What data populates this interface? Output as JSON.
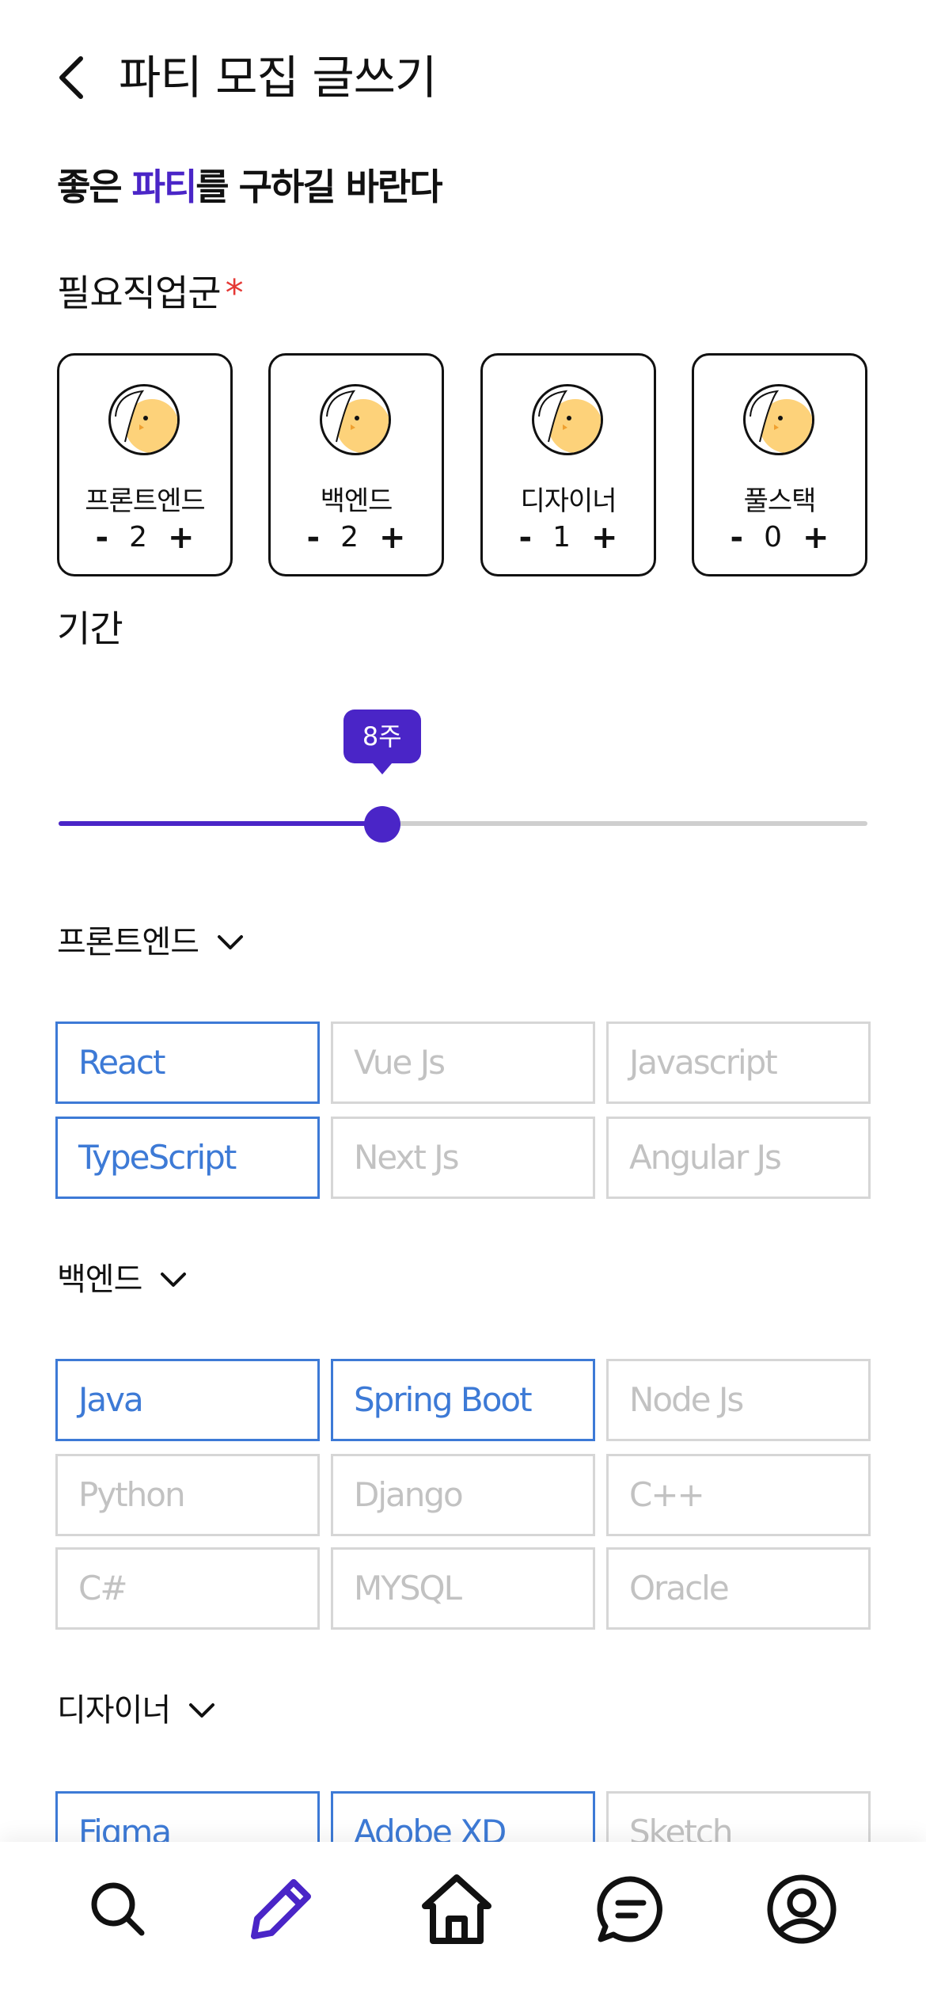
{
  "header": {
    "title": "파티 모집 글쓰기"
  },
  "headline": {
    "before": "좋은 ",
    "accent": "파티",
    "after": "를 구하길 바란다"
  },
  "roles_section": {
    "label": "필요직업군",
    "required_mark": "*"
  },
  "roles": [
    {
      "name": "프론트엔드",
      "count": "2",
      "minus": "-",
      "plus": "+"
    },
    {
      "name": "백엔드",
      "count": "2",
      "minus": "-",
      "plus": "+"
    },
    {
      "name": "디자이너",
      "count": "1",
      "minus": "-",
      "plus": "+"
    },
    {
      "name": "풀스택",
      "count": "0",
      "minus": "-",
      "plus": "+"
    }
  ],
  "period": {
    "label": "기간",
    "value_label": "8주",
    "fraction": 0.4
  },
  "frontend": {
    "label": "프론트엔드",
    "skills": [
      {
        "name": "React",
        "selected": true
      },
      {
        "name": "Vue Js",
        "selected": false
      },
      {
        "name": "Javascript",
        "selected": false
      },
      {
        "name": "TypeScript",
        "selected": true
      },
      {
        "name": "Next Js",
        "selected": false
      },
      {
        "name": "Angular Js",
        "selected": false
      }
    ]
  },
  "backend": {
    "label": "백엔드",
    "skills": [
      {
        "name": "Java",
        "selected": true
      },
      {
        "name": "Spring Boot",
        "selected": true
      },
      {
        "name": "Node Js",
        "selected": false
      },
      {
        "name": "Python",
        "selected": false
      },
      {
        "name": "Django",
        "selected": false
      },
      {
        "name": "C++",
        "selected": false
      },
      {
        "name": "C#",
        "selected": false
      },
      {
        "name": "MYSQL",
        "selected": false
      },
      {
        "name": "Oracle",
        "selected": false
      }
    ]
  },
  "designer": {
    "label": "디자이너",
    "skills": [
      {
        "name": "Figma",
        "selected": true
      },
      {
        "name": "Adobe XD",
        "selected": true
      },
      {
        "name": "Sketch",
        "selected": false
      }
    ]
  },
  "nav": {
    "items": [
      {
        "icon": "search-icon"
      },
      {
        "icon": "pencil-icon",
        "active": true
      },
      {
        "icon": "home-icon"
      },
      {
        "icon": "chat-icon"
      },
      {
        "icon": "profile-icon"
      }
    ]
  },
  "colors": {
    "accent": "#4a25c7",
    "selected": "#3d7ad6",
    "unselected": "#c2c2c2",
    "required": "#e53935"
  }
}
